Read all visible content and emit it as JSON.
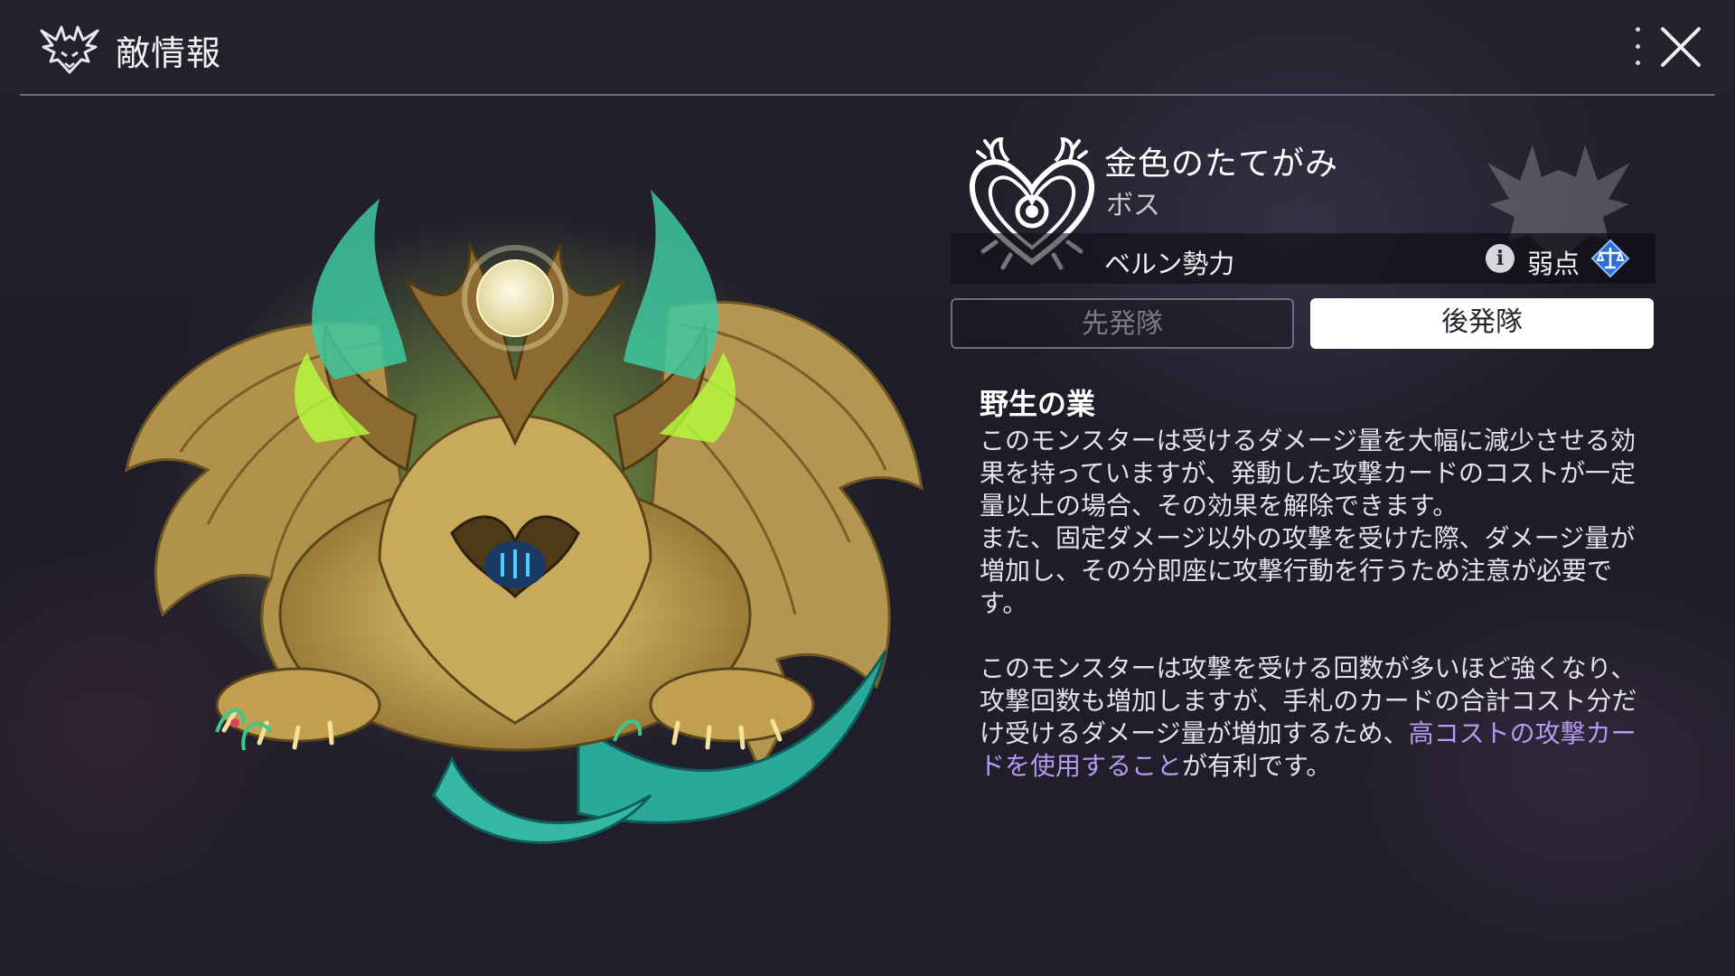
{
  "header": {
    "title": "敵情報",
    "emblem_icon": "demon-crest-icon",
    "more_icon": "vertical-ellipsis-icon",
    "close_icon": "close-icon"
  },
  "monster": {
    "name": "金色のたてがみ",
    "rank": "ボス",
    "faction": "ベルン勢力",
    "faction_icon": "heart-wreath-emblem-icon",
    "weakness_label": "弱点",
    "weakness_icon": "balance-scale-icon",
    "info_icon": "info-icon"
  },
  "tabs": [
    {
      "label": "先発隊",
      "active": false
    },
    {
      "label": "後発隊",
      "active": true
    }
  ],
  "skill": {
    "title": "野生の業",
    "description_part1": "このモンスターは受けるダメージ量を大幅に減少させる効果を持っていますが、発動した攻撃カードのコストが一定量以上の場合、その効果を解除できます。\nまた、固定ダメージ以外の攻撃を受けた際、ダメージ量が増加し、その分即座に攻撃行動を行うため注意が必要です。\n\nこのモンスターは攻撃を受ける回数が多いほど強くなり、攻撃回数も増加しますが、手札のカードの合計コスト分だけ受けるダメージ量が増加するため、",
    "description_highlight": "高コストの攻撃カードを使用すること",
    "description_part2": "が有利です。"
  },
  "colors": {
    "highlight": "#b69cf0",
    "active_tab_bg": "#ffffff",
    "inactive_tab_border": "#6f6d78"
  }
}
